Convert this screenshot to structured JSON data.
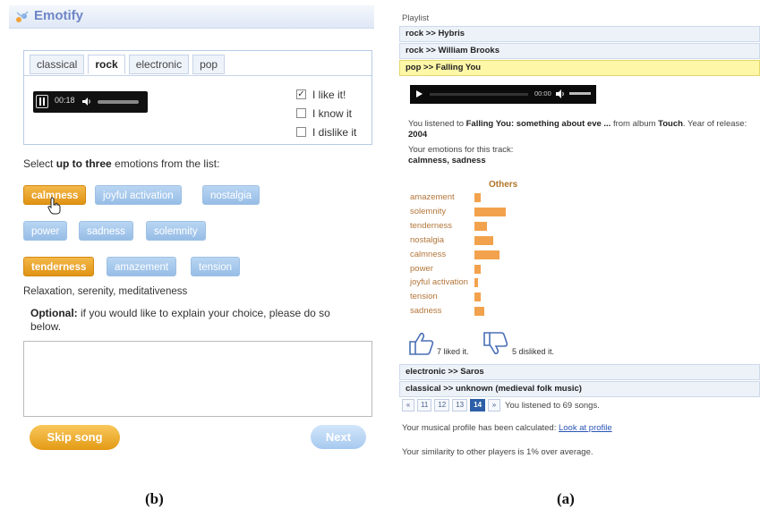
{
  "panel_b": {
    "app_name": "Emotify",
    "tabs": [
      {
        "label": "classical",
        "active": false
      },
      {
        "label": "rock",
        "active": true
      },
      {
        "label": "electronic",
        "active": false
      },
      {
        "label": "pop",
        "active": false
      }
    ],
    "player": {
      "time": "00:18"
    },
    "checkboxes": [
      {
        "label": "I like it!",
        "checked": true
      },
      {
        "label": "I know it",
        "checked": false
      },
      {
        "label": "I dislike it",
        "checked": false
      }
    ],
    "instruction": {
      "prefix": "Select ",
      "bold": "up to three",
      "suffix": " emotions from the list:"
    },
    "emotions": [
      {
        "label": "calmness",
        "selected": true
      },
      {
        "label": "joyful activation",
        "selected": false
      },
      {
        "label": "nostalgia",
        "selected": false
      },
      {
        "label": "power",
        "selected": false
      },
      {
        "label": "sadness",
        "selected": false
      },
      {
        "label": "solemnity",
        "selected": false
      },
      {
        "label": "tenderness",
        "selected": true
      },
      {
        "label": "amazement",
        "selected": false
      },
      {
        "label": "tension",
        "selected": false
      }
    ],
    "emotion_description": "Relaxation, serenity, meditativeness",
    "optional": {
      "bold": "Optional:",
      "text": " if you would like to explain your choice, please do so below."
    },
    "comment_value": "",
    "skip_label": "Skip song",
    "next_label": "Next",
    "caption": "(b)"
  },
  "panel_a": {
    "playlist_title": "Playlist",
    "playlist_top": [
      {
        "label": "rock >> Hybris",
        "active": false
      },
      {
        "label": "rock >> William Brooks",
        "active": false
      },
      {
        "label": "pop >> Falling You",
        "active": true
      }
    ],
    "player": {
      "time": "00:00"
    },
    "info": {
      "p1": "You listened to ",
      "track": "Falling You: something about eve ...",
      "p2": " from album ",
      "album": "Touch",
      "p3": ". Year of release: ",
      "year": "2004"
    },
    "emotions_label": "Your emotions for this track:",
    "emotions_value": "calmness, sadness",
    "chart_data": {
      "type": "bar",
      "title": "Others",
      "orientation": "horizontal",
      "categories": [
        "amazement",
        "solemnity",
        "tenderness",
        "nostalgia",
        "calmness",
        "power",
        "joyful activation",
        "tension",
        "sadness"
      ],
      "values": [
        1,
        5,
        2,
        3,
        4,
        1,
        0.5,
        1,
        1.5
      ],
      "color": "#f2a24c"
    },
    "liked_text": "7 liked it.",
    "disliked_text": "5 disliked it.",
    "playlist_bottom": [
      {
        "label": "electronic >> Saros",
        "active": false
      },
      {
        "label": "classical >> unknown (medieval folk music)",
        "active": false
      }
    ],
    "pager": {
      "prev": "«",
      "pages": [
        "11",
        "12",
        "13",
        "14"
      ],
      "current": "14",
      "next": "»",
      "text": "You listened to 69 songs."
    },
    "profile_text": "Your musical profile has been calculated: ",
    "profile_link": "Look at profile",
    "similarity_text": "Your similarity to other players is 1% over average.",
    "caption": "(a)"
  }
}
